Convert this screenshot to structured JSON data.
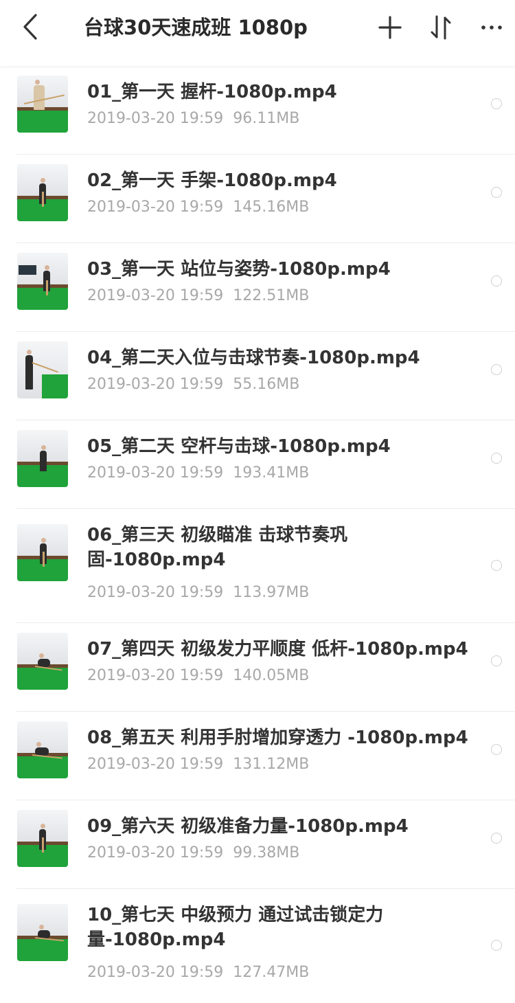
{
  "header": {
    "title": "台球30天速成班  1080p"
  },
  "files": [
    {
      "name": "01_第一天 握杆-1080p.mp4",
      "date": "2019-03-20  19:59",
      "size": "96.11MB"
    },
    {
      "name": "02_第一天 手架-1080p.mp4",
      "date": "2019-03-20  19:59",
      "size": "145.16MB"
    },
    {
      "name": "03_第一天 站位与姿势-1080p.mp4",
      "date": "2019-03-20  19:59",
      "size": "122.51MB"
    },
    {
      "name": "04_第二天入位与击球节奏-1080p.mp4",
      "date": "2019-03-20  19:59",
      "size": "55.16MB"
    },
    {
      "name": "05_第二天 空杆与击球-1080p.mp4",
      "date": "2019-03-20  19:59",
      "size": "193.41MB"
    },
    {
      "name": "06_第三天 初级瞄准 击球节奏巩固-1080p.mp4",
      "date": "2019-03-20  19:59",
      "size": "113.97MB"
    },
    {
      "name": "07_第四天 初级发力平顺度 低杆-1080p.mp4",
      "date": "2019-03-20  19:59",
      "size": "140.05MB"
    },
    {
      "name": "08_第五天 利用手肘增加穿透力 -1080p.mp4",
      "date": "2019-03-20  19:59",
      "size": "131.12MB"
    },
    {
      "name": "09_第六天 初级准备力量-1080p.mp4",
      "date": "2019-03-20  19:59",
      "size": "99.38MB"
    },
    {
      "name": "10_第七天 中级预力 通过试击锁定力量-1080p.mp4",
      "date": "2019-03-20  19:59",
      "size": "127.47MB"
    }
  ],
  "icons": {
    "back": "chevron-left-icon",
    "add": "plus-icon",
    "sort": "sort-arrows-icon",
    "more": "ellipsis-icon",
    "thumbnail": "video-thumbnail",
    "select": "radio-circle-icon"
  },
  "colors": {
    "title_text": "#2a2a2a",
    "filename_text": "#333333",
    "meta_text": "#a8a8a8",
    "divider": "#ececec",
    "table_felt": "#1fa33a"
  }
}
